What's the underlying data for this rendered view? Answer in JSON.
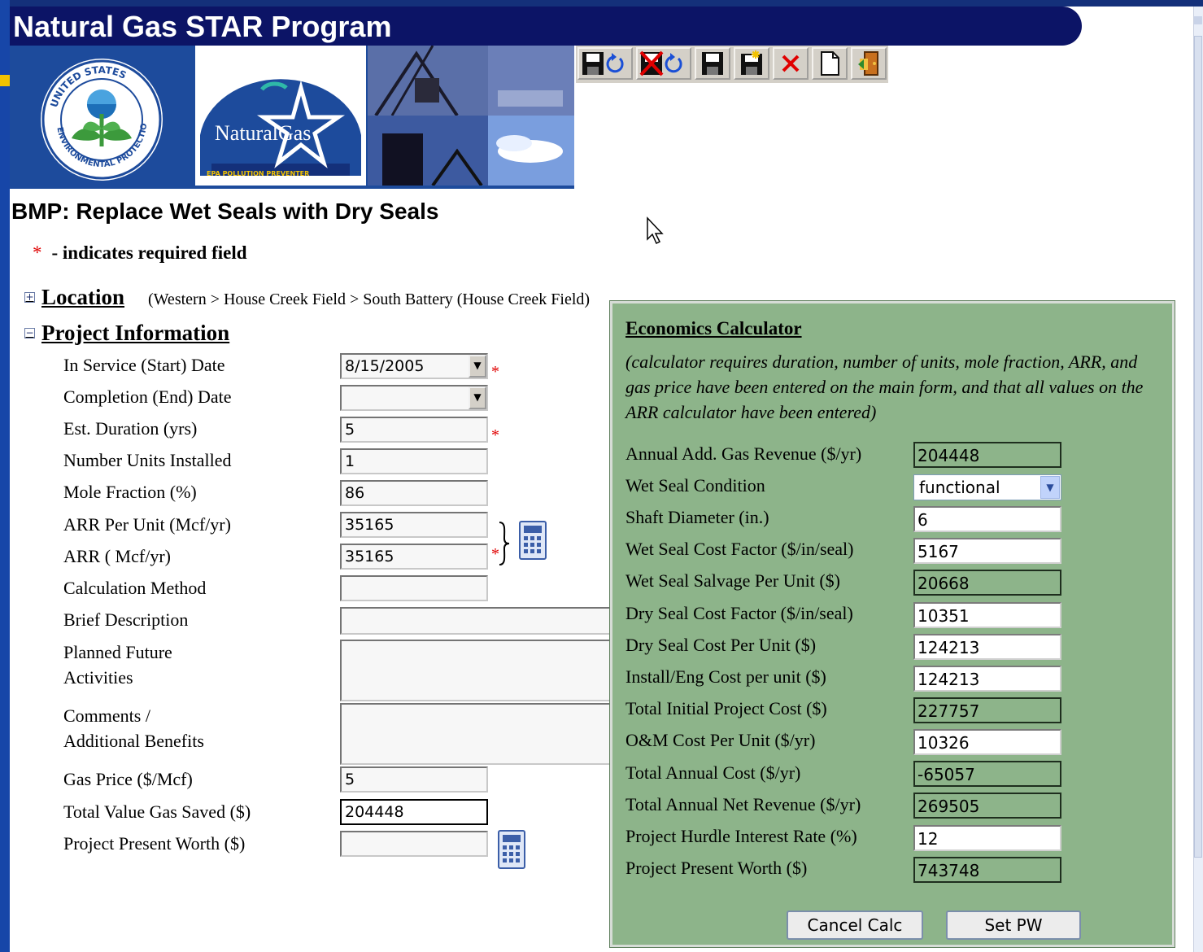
{
  "app": {
    "title": "Natural Gas STAR Program"
  },
  "banner": {
    "seal_text": "UNITED STATES ENVIRONMENTAL PROTECTION AGENCY",
    "logo_text": "NaturalGas",
    "logo_subtext": "EPA POLLUTION PREVENTER"
  },
  "toolbar": {
    "buttons": [
      {
        "name": "save-and-refresh",
        "icon": "save-refresh-icon"
      },
      {
        "name": "cancel-and-refresh",
        "icon": "cancel-refresh-icon"
      },
      {
        "name": "save",
        "icon": "floppy-disk-icon"
      },
      {
        "name": "save-new",
        "icon": "save-new-icon"
      },
      {
        "name": "delete",
        "icon": "red-x-icon"
      },
      {
        "name": "new",
        "icon": "blank-page-icon"
      },
      {
        "name": "exit",
        "icon": "exit-door-icon"
      }
    ]
  },
  "page": {
    "bmp_title": "BMP: Replace Wet Seals with Dry Seals",
    "required_star": "*",
    "required_note": "- indicates required field",
    "location": {
      "label": "Location",
      "path": "(Western > House Creek Field > South Battery (House Creek Field)"
    },
    "project_info": {
      "label": "Project Information"
    }
  },
  "form": {
    "in_service_date": {
      "label": "In Service (Start) Date",
      "value": "8/15/2005"
    },
    "completion_date": {
      "label": "Completion (End) Date",
      "value": ""
    },
    "est_duration": {
      "label": "Est. Duration (yrs)",
      "value": "5"
    },
    "number_units": {
      "label": "Number Units Installed",
      "value": "1"
    },
    "mole_fraction": {
      "label": "Mole Fraction (%)",
      "value": "86"
    },
    "arr_per_unit": {
      "label": "ARR Per Unit (Mcf/yr)",
      "value": "35165"
    },
    "arr": {
      "label": "ARR ( Mcf/yr)",
      "value": "35165"
    },
    "calc_method": {
      "label": "Calculation Method",
      "value": ""
    },
    "brief_description": {
      "label": "Brief Description"
    },
    "planned_future_line1": "Planned Future",
    "planned_future_line2": "Activities",
    "comments_line1": "Comments /",
    "comments_line2": "Additional Benefits",
    "gas_price": {
      "label": "Gas Price ($/Mcf)",
      "value": "5"
    },
    "total_value_gas_saved": {
      "label": "Total Value Gas Saved ($)",
      "value": "204448"
    },
    "project_present_worth": {
      "label": "Project Present Worth ($)",
      "value": ""
    }
  },
  "calculator": {
    "title": "Economics Calculator",
    "note": "(calculator requires duration, number of units, mole fraction, ARR, and gas price have been entered on the main form, and that all values on the ARR calculator have been entered)",
    "fields": [
      {
        "label": "Annual Add. Gas Revenue ($/yr)",
        "value": "204448",
        "readonly": true
      },
      {
        "label": "Wet Seal Condition",
        "value": "functional",
        "select": true
      },
      {
        "label": "Shaft Diameter (in.)",
        "value": "6",
        "readonly": false
      },
      {
        "label": "Wet Seal Cost Factor ($/in/seal)",
        "value": "5167",
        "readonly": false
      },
      {
        "label": "Wet Seal Salvage Per Unit ($)",
        "value": "20668",
        "readonly": true
      },
      {
        "label": "Dry Seal Cost Factor ($/in/seal)",
        "value": "10351",
        "readonly": false
      },
      {
        "label": "Dry Seal Cost Per Unit ($)",
        "value": "124213",
        "readonly": false
      },
      {
        "label": "Install/Eng Cost per unit ($)",
        "value": "124213",
        "readonly": false
      },
      {
        "label": "Total Initial Project Cost ($)",
        "value": "227757",
        "readonly": true
      },
      {
        "label": "O&M Cost Per Unit ($/yr)",
        "value": "10326",
        "readonly": false
      },
      {
        "label": "Total Annual Cost ($/yr)",
        "value": "-65057",
        "readonly": true
      },
      {
        "label": "Total Annual Net Revenue ($/yr)",
        "value": "269505",
        "readonly": true
      },
      {
        "label": "Project Hurdle Interest Rate (%)",
        "value": "12",
        "readonly": false
      },
      {
        "label": "Project Present Worth ($)",
        "value": "743748",
        "readonly": true
      }
    ],
    "cancel_label": "Cancel Calc",
    "set_pw_label": "Set PW"
  },
  "colors": {
    "title_bar": "#0c1466",
    "calculator_bg": "#8db48a",
    "required": "#e00000"
  }
}
